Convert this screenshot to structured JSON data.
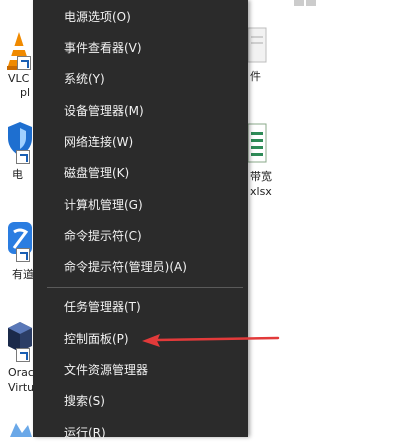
{
  "desktop": {
    "left_icons": [
      {
        "name": "vlc",
        "label_line1": "VLC",
        "label_line2": "pl"
      },
      {
        "name": "security-app",
        "label": "电"
      },
      {
        "name": "youdao",
        "label": "有道"
      },
      {
        "name": "oracle-virtualbox",
        "label_line1": "Orac",
        "label_line2": "Virtu"
      }
    ],
    "right_items": {
      "file_label_line1": "带宽",
      "file_label_line2": "xlsx",
      "folder_label": "件"
    }
  },
  "menu": {
    "group1": [
      {
        "label": "电源选项(O)",
        "id": "power-options"
      },
      {
        "label": "事件查看器(V)",
        "id": "event-viewer"
      },
      {
        "label": "系统(Y)",
        "id": "system"
      },
      {
        "label": "设备管理器(M)",
        "id": "device-manager"
      },
      {
        "label": "网络连接(W)",
        "id": "network-connections"
      },
      {
        "label": "磁盘管理(K)",
        "id": "disk-management"
      },
      {
        "label": "计算机管理(G)",
        "id": "computer-management"
      },
      {
        "label": "命令提示符(C)",
        "id": "command-prompt"
      },
      {
        "label": "命令提示符(管理员)(A)",
        "id": "command-prompt-admin"
      }
    ],
    "group2": [
      {
        "label": "任务管理器(T)",
        "id": "task-manager"
      },
      {
        "label": "控制面板(P)",
        "id": "control-panel"
      },
      {
        "label": "文件资源管理器",
        "id": "file-explorer"
      },
      {
        "label": "搜索(S)",
        "id": "search"
      },
      {
        "label": "运行(R)",
        "id": "run"
      }
    ]
  },
  "colors": {
    "menu_bg": "#2b2b2b",
    "menu_text": "#f2f2f2",
    "arrow": "#e23a3a"
  }
}
